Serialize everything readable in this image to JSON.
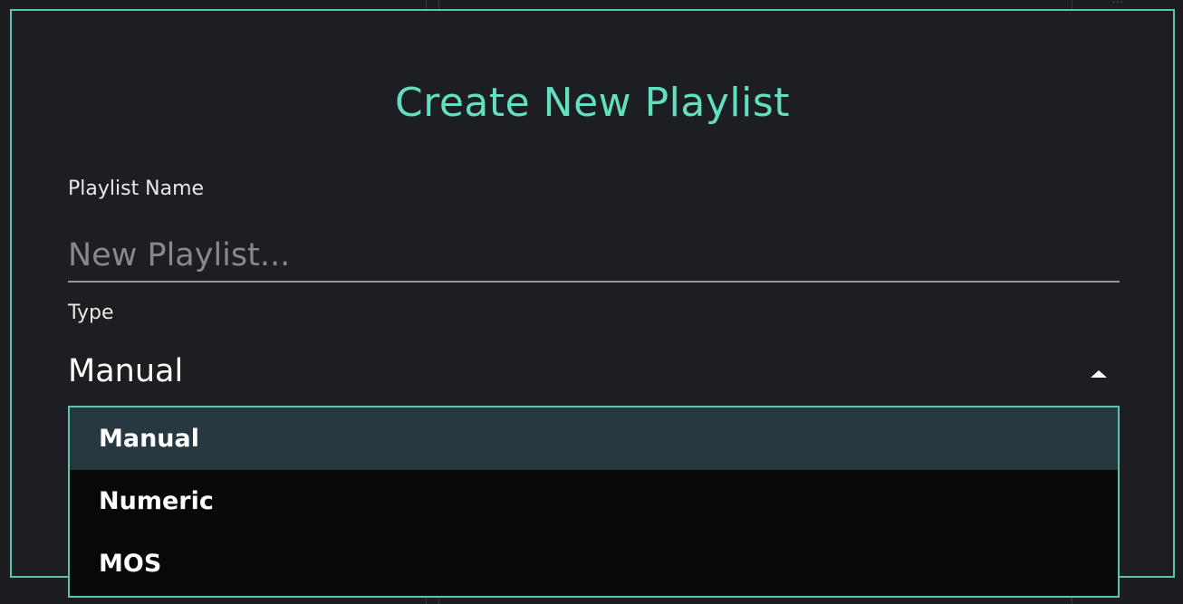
{
  "dialog": {
    "title": "Create New Playlist",
    "playlist_name": {
      "label": "Playlist Name",
      "value": "",
      "placeholder": "New Playlist..."
    },
    "type": {
      "label": "Type",
      "selected": "Manual",
      "options": [
        "Manual",
        "Numeric",
        "MOS"
      ],
      "expanded": true
    }
  },
  "colors": {
    "accent": "#62dfc0",
    "border": "#5bc4ad",
    "background": "#1d1e21",
    "dropdown_bg": "#080808",
    "selected_option_bg": "#283840"
  },
  "icons": {
    "select_arrow": "caret-up-icon",
    "background_menu": "more-dots-icon"
  }
}
